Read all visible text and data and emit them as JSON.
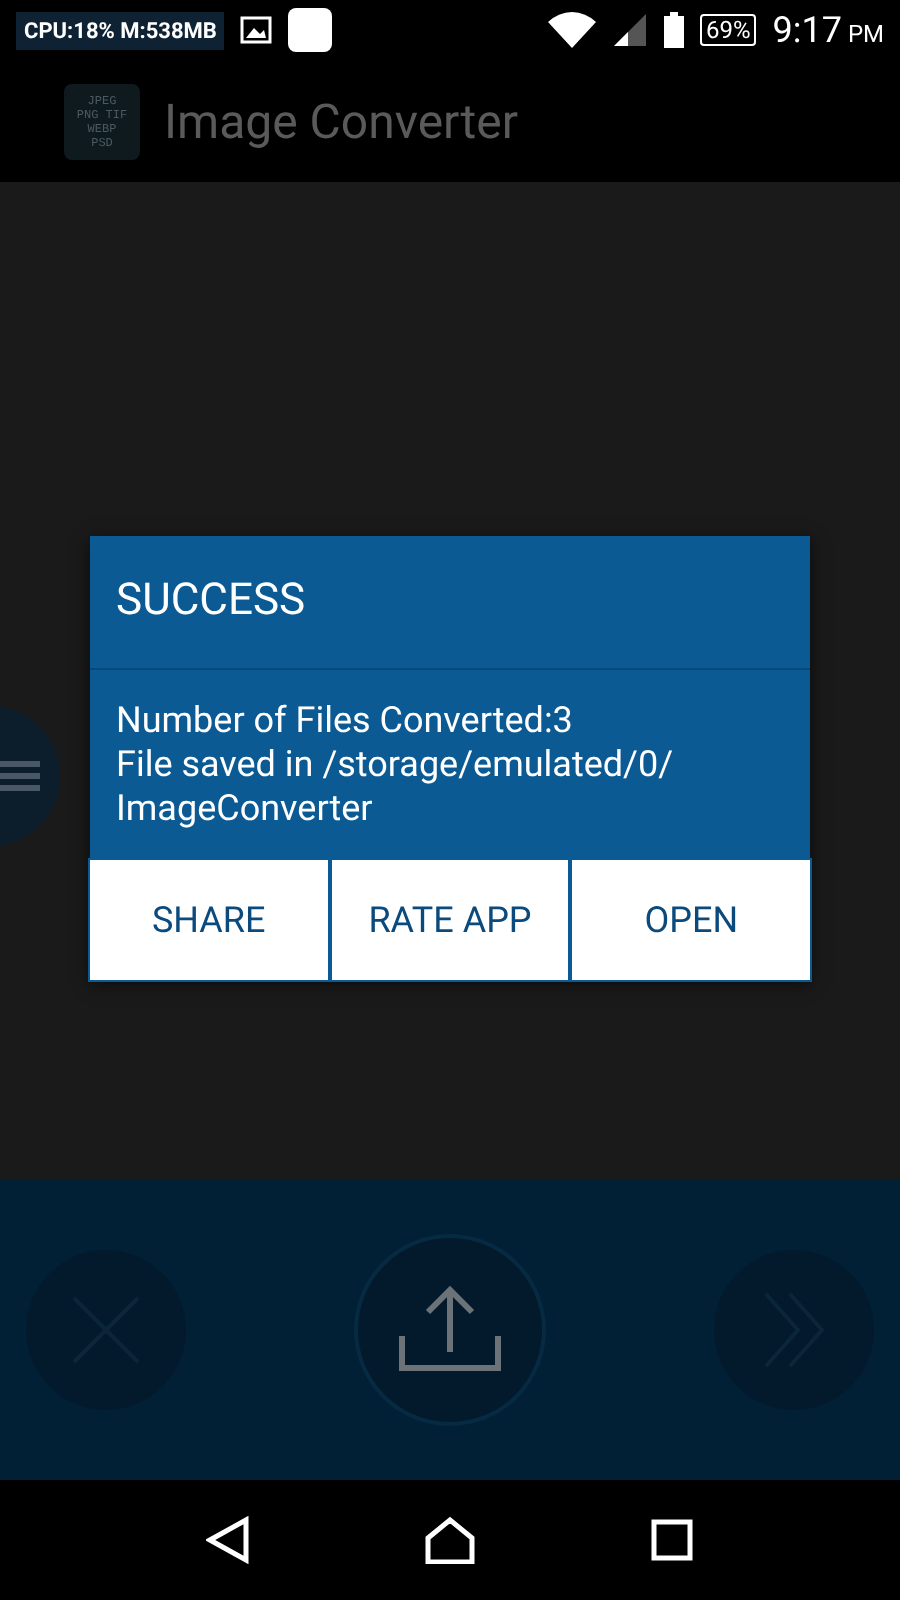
{
  "status_bar": {
    "stats": "CPU:18% M:538MB",
    "battery": "69%",
    "time": "9:17",
    "ampm": "PM"
  },
  "app_bar": {
    "logo_lines": [
      "JPEG",
      "PNG TIF",
      "WEBP",
      "PSD"
    ],
    "title": "Image Converter"
  },
  "dialog": {
    "title": "SUCCESS",
    "message_lines": [
      "Number of Files Converted:3",
      "File saved in /storage/emulated/0/",
      "ImageConverter"
    ],
    "buttons": [
      "SHARE",
      "RATE APP",
      "OPEN"
    ]
  }
}
